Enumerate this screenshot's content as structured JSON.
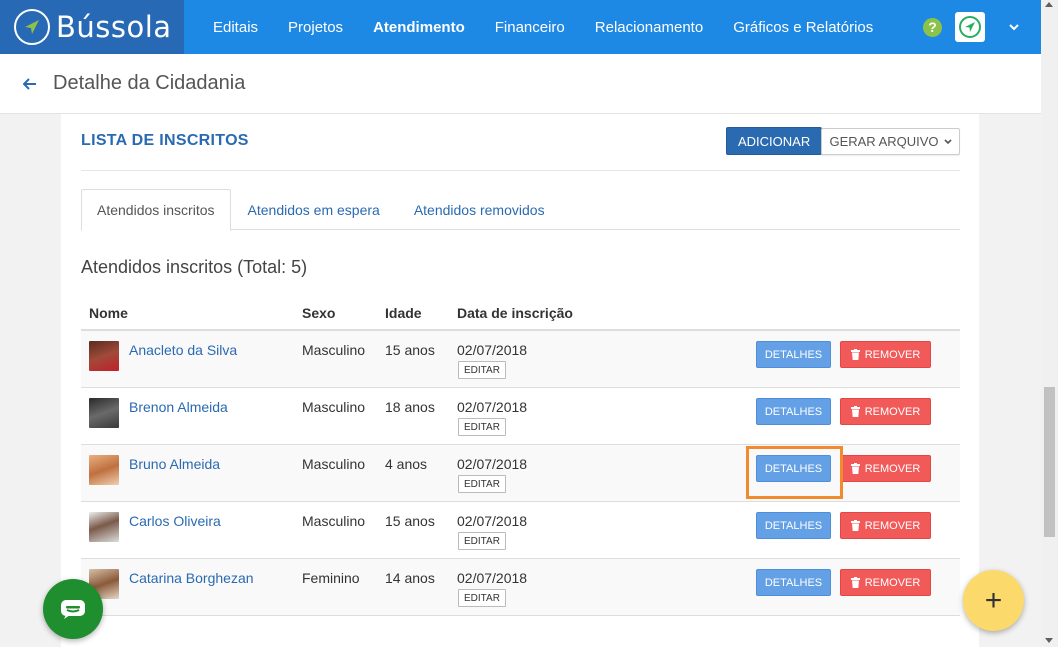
{
  "brand": {
    "name": "Bússola"
  },
  "nav": {
    "items": [
      {
        "label": "Editais"
      },
      {
        "label": "Projetos"
      },
      {
        "label": "Atendimento"
      },
      {
        "label": "Financeiro"
      },
      {
        "label": "Relacionamento"
      },
      {
        "label": "Gráficos e Relatórios"
      }
    ],
    "help": "?"
  },
  "subheader": {
    "title": "Detalhe da Cidadania"
  },
  "card": {
    "title": "LISTA DE INSCRITOS",
    "add_label": "ADICIONAR",
    "generate_label": "GERAR ARQUIVO"
  },
  "tabs": [
    {
      "label": "Atendidos inscritos"
    },
    {
      "label": "Atendidos em espera"
    },
    {
      "label": "Atendidos removidos"
    }
  ],
  "list": {
    "heading": "Atendidos inscritos (Total: 5)",
    "columns": {
      "name": "Nome",
      "sex": "Sexo",
      "age": "Idade",
      "date": "Data de inscrição"
    },
    "rows": [
      {
        "name": "Anacleto da Silva",
        "sex": "Masculino",
        "age": "15 anos",
        "date": "02/07/2018",
        "edit": "EDITAR",
        "details": "DETALHES",
        "remove": "REMOVER"
      },
      {
        "name": "Brenon Almeida",
        "sex": "Masculino",
        "age": "18 anos",
        "date": "02/07/2018",
        "edit": "EDITAR",
        "details": "DETALHES",
        "remove": "REMOVER"
      },
      {
        "name": "Bruno Almeida",
        "sex": "Masculino",
        "age": "4 anos",
        "date": "02/07/2018",
        "edit": "EDITAR",
        "details": "DETALHES",
        "remove": "REMOVER"
      },
      {
        "name": "Carlos Oliveira",
        "sex": "Masculino",
        "age": "15 anos",
        "date": "02/07/2018",
        "edit": "EDITAR",
        "details": "DETALHES",
        "remove": "REMOVER"
      },
      {
        "name": "Catarina Borghezan",
        "sex": "Feminino",
        "age": "14 anos",
        "date": "02/07/2018",
        "edit": "EDITAR",
        "details": "DETALHES",
        "remove": "REMOVER"
      }
    ]
  },
  "fab": {
    "add": "+"
  },
  "colors": {
    "primary": "#1e88e5",
    "brand_dark": "#2769b5",
    "link": "#2a6ab1",
    "details": "#64a0e6",
    "remove": "#f25a5a",
    "highlight": "#f28a2e",
    "chat": "#1e8e2e",
    "fab": "#fbd96a"
  }
}
